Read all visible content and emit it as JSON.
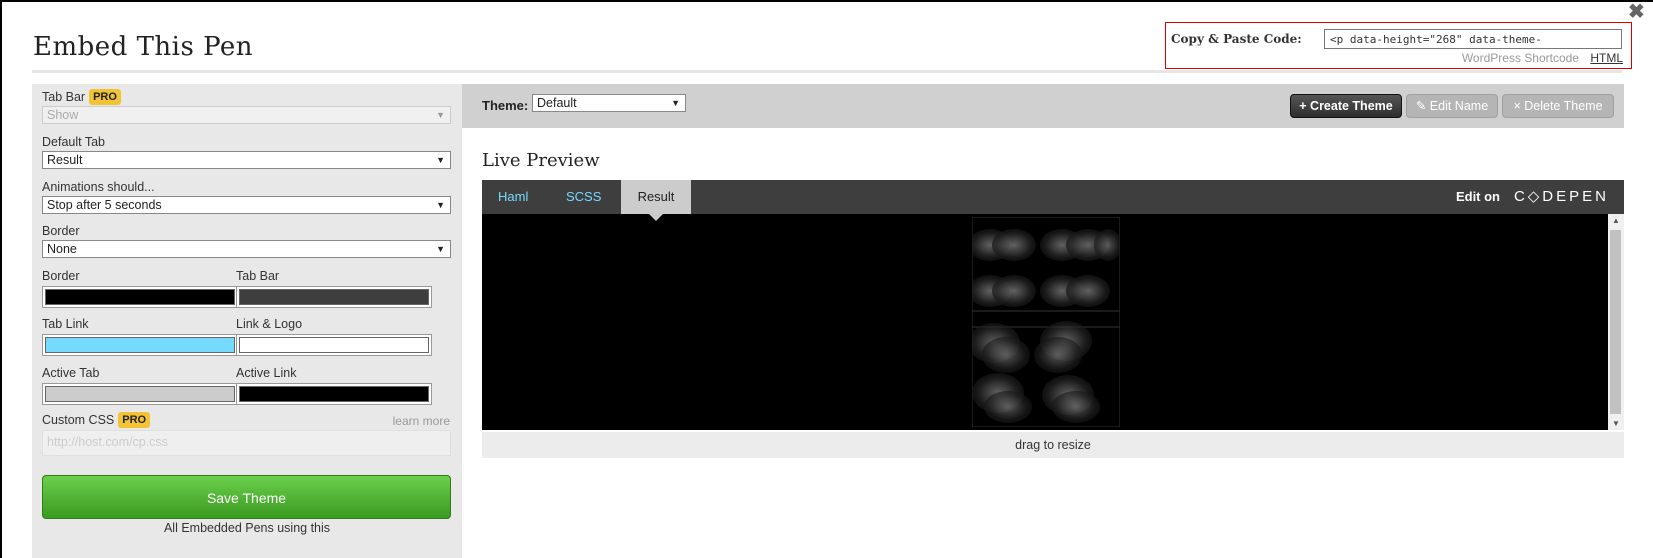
{
  "title": "Embed This Pen",
  "close_glyph": "✖",
  "copy": {
    "label": "Copy & Paste Code:",
    "code": "<p data-height=\"268\" data-theme-",
    "wp_link": "WordPress Shortcode",
    "html_link": "HTML"
  },
  "sidebar": {
    "tab_bar": {
      "label": "Tab Bar",
      "badge": "PRO",
      "value": "Show"
    },
    "default_tab": {
      "label": "Default Tab",
      "value": "Result"
    },
    "animations": {
      "label": "Animations should...",
      "value": "Stop after 5 seconds"
    },
    "border": {
      "label": "Border",
      "value": "None"
    },
    "colors": [
      {
        "label": "Border",
        "color": "#000000"
      },
      {
        "label": "Tab Bar",
        "color": "#3e3e3e"
      },
      {
        "label": "Tab Link",
        "color": "#76daff"
      },
      {
        "label": "Link & Logo",
        "color": "#ffffff"
      },
      {
        "label": "Active Tab",
        "color": "#cccccc"
      },
      {
        "label": "Active Link",
        "color": "#000000"
      }
    ],
    "custom_css": {
      "label": "Custom CSS",
      "badge": "PRO",
      "learn_more": "learn more",
      "placeholder": "http://host.com/cp.css"
    },
    "save_button": "Save Theme",
    "embed_note": "All Embedded Pens using this"
  },
  "theme_bar": {
    "label": "Theme:",
    "value": "Default",
    "create": "+ Create Theme",
    "edit": "✎ Edit Name",
    "delete": "× Delete Theme"
  },
  "preview": {
    "title": "Live Preview",
    "tabs": [
      "Haml",
      "SCSS",
      "Result"
    ],
    "edit_on": "Edit on",
    "logo": "C◇DEPEN",
    "resize": "drag to resize"
  },
  "theme_colors": {
    "save_green": "#3a9a21",
    "tab_link": "#76daff",
    "pro_badge": "#f2c335"
  }
}
